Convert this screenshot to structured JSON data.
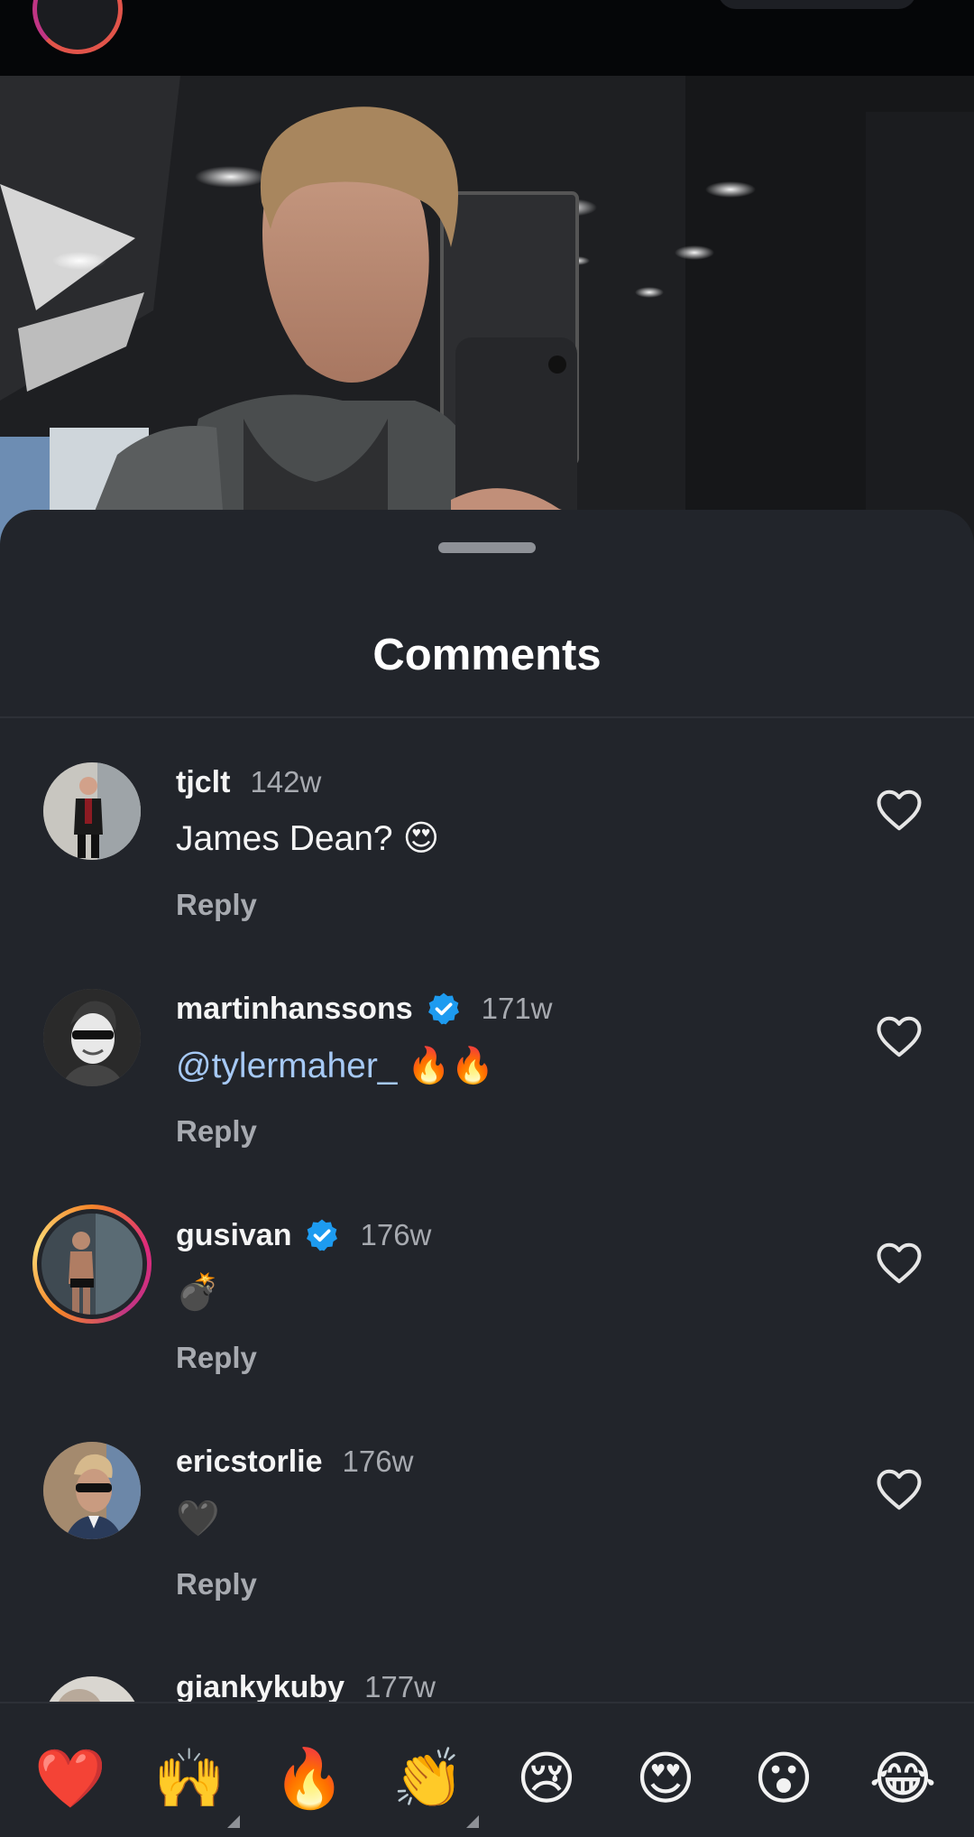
{
  "sheet": {
    "title": "Comments"
  },
  "comments": [
    {
      "username": "tjclt",
      "time": "142w",
      "text": "James Dean? 😍",
      "reply": "Reply",
      "verified": false,
      "story": false
    },
    {
      "username": "martinhanssons",
      "time": "171w",
      "mention": "@tylermaher_",
      "text": " 🔥🔥",
      "reply": "Reply",
      "verified": true,
      "story": false
    },
    {
      "username": "gusivan",
      "time": "176w",
      "text": "💣",
      "reply": "Reply",
      "verified": true,
      "story": true
    },
    {
      "username": "ericstorlie",
      "time": "176w",
      "text": "🖤",
      "reply": "Reply",
      "verified": false,
      "story": false
    },
    {
      "username": "giankykuby",
      "time": "177w"
    }
  ],
  "emoji_bar": [
    "❤️",
    "🙌",
    "🔥",
    "👏",
    "😢",
    "😍",
    "😮",
    "😂"
  ],
  "colors": {
    "sheet_background": "#22252b",
    "verified": "#1d9bf0",
    "mention": "#a6c9f5",
    "secondary_text": "#a7aab0"
  }
}
